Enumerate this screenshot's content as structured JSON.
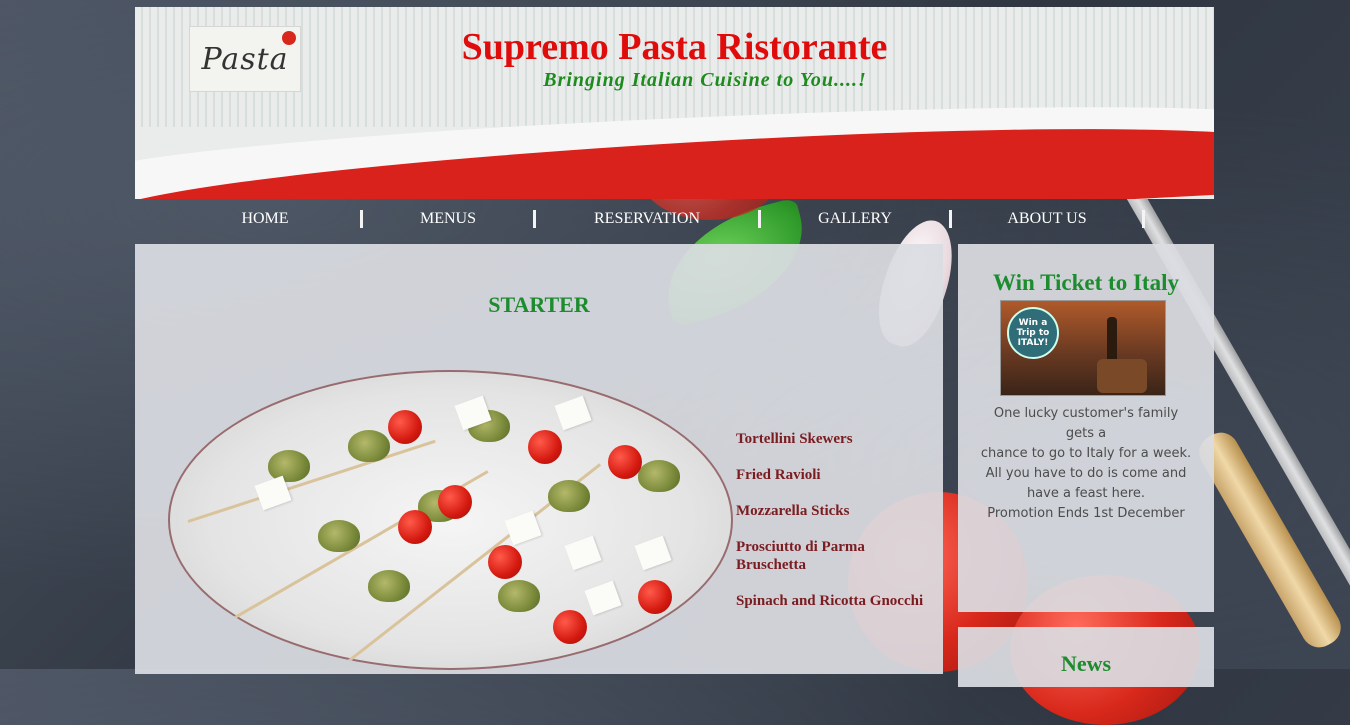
{
  "header": {
    "logo_text": "Pasta",
    "title": "Supremo Pasta Ristorante",
    "tagline": "Bringing Italian Cuisine to You....!"
  },
  "nav": {
    "items": [
      {
        "label": "HOME"
      },
      {
        "label": "MENUS"
      },
      {
        "label": "RESERVATION"
      },
      {
        "label": "GALLERY"
      },
      {
        "label": "ABOUT US"
      }
    ]
  },
  "main": {
    "section_title": "STARTER",
    "menu_items": [
      "Tortellini Skewers",
      "Fried Ravioli",
      "Mozzarella Sticks",
      "Prosciutto di Parma Bruschetta",
      "Spinach and Ricotta Gnocchi"
    ]
  },
  "sidebar": {
    "promo": {
      "title": "Win Ticket to Italy",
      "badge_text": "Win a Trip to ITALY!",
      "text_lines": [
        "One lucky customer's family gets a",
        "chance to go to Italy for a week.",
        "All you have to do is come and",
        "have a feast here.",
        "Promotion Ends 1st December"
      ]
    },
    "news": {
      "title": "News"
    }
  },
  "colors": {
    "title_red": "#e00c0c",
    "accent_green": "#1c8c2e",
    "menu_item": "#7a1c20"
  }
}
